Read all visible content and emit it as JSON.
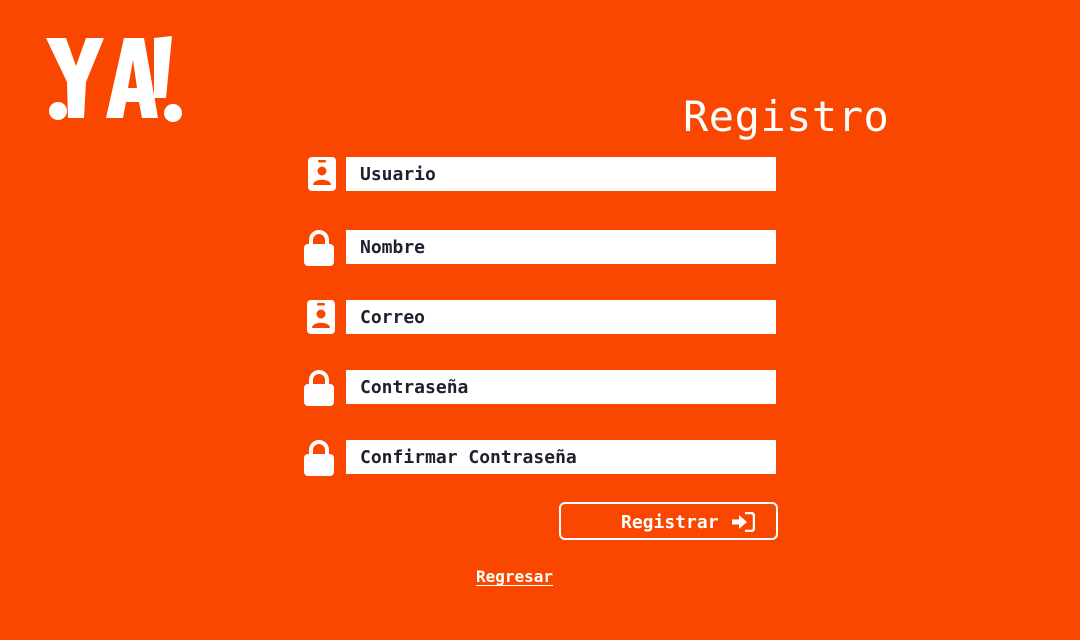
{
  "brand": {
    "logo_text": "YA!"
  },
  "page": {
    "title": "Registro"
  },
  "form": {
    "fields": [
      {
        "placeholder": "Usuario",
        "icon": "id-badge-icon"
      },
      {
        "placeholder": "Nombre",
        "icon": "lock-icon"
      },
      {
        "placeholder": "Correo",
        "icon": "id-badge-icon"
      },
      {
        "placeholder": "Contraseña",
        "icon": "lock-icon"
      },
      {
        "placeholder": "Confirmar Contraseña",
        "icon": "lock-icon"
      }
    ],
    "submit_label": "Registrar",
    "submit_icon": "sign-in-icon",
    "back_label": "Regresar"
  },
  "colors": {
    "background": "#FA4700",
    "input_background": "#FFFFFF",
    "text_dark": "#1F1F2E",
    "text_light": "#FFFFFF"
  }
}
